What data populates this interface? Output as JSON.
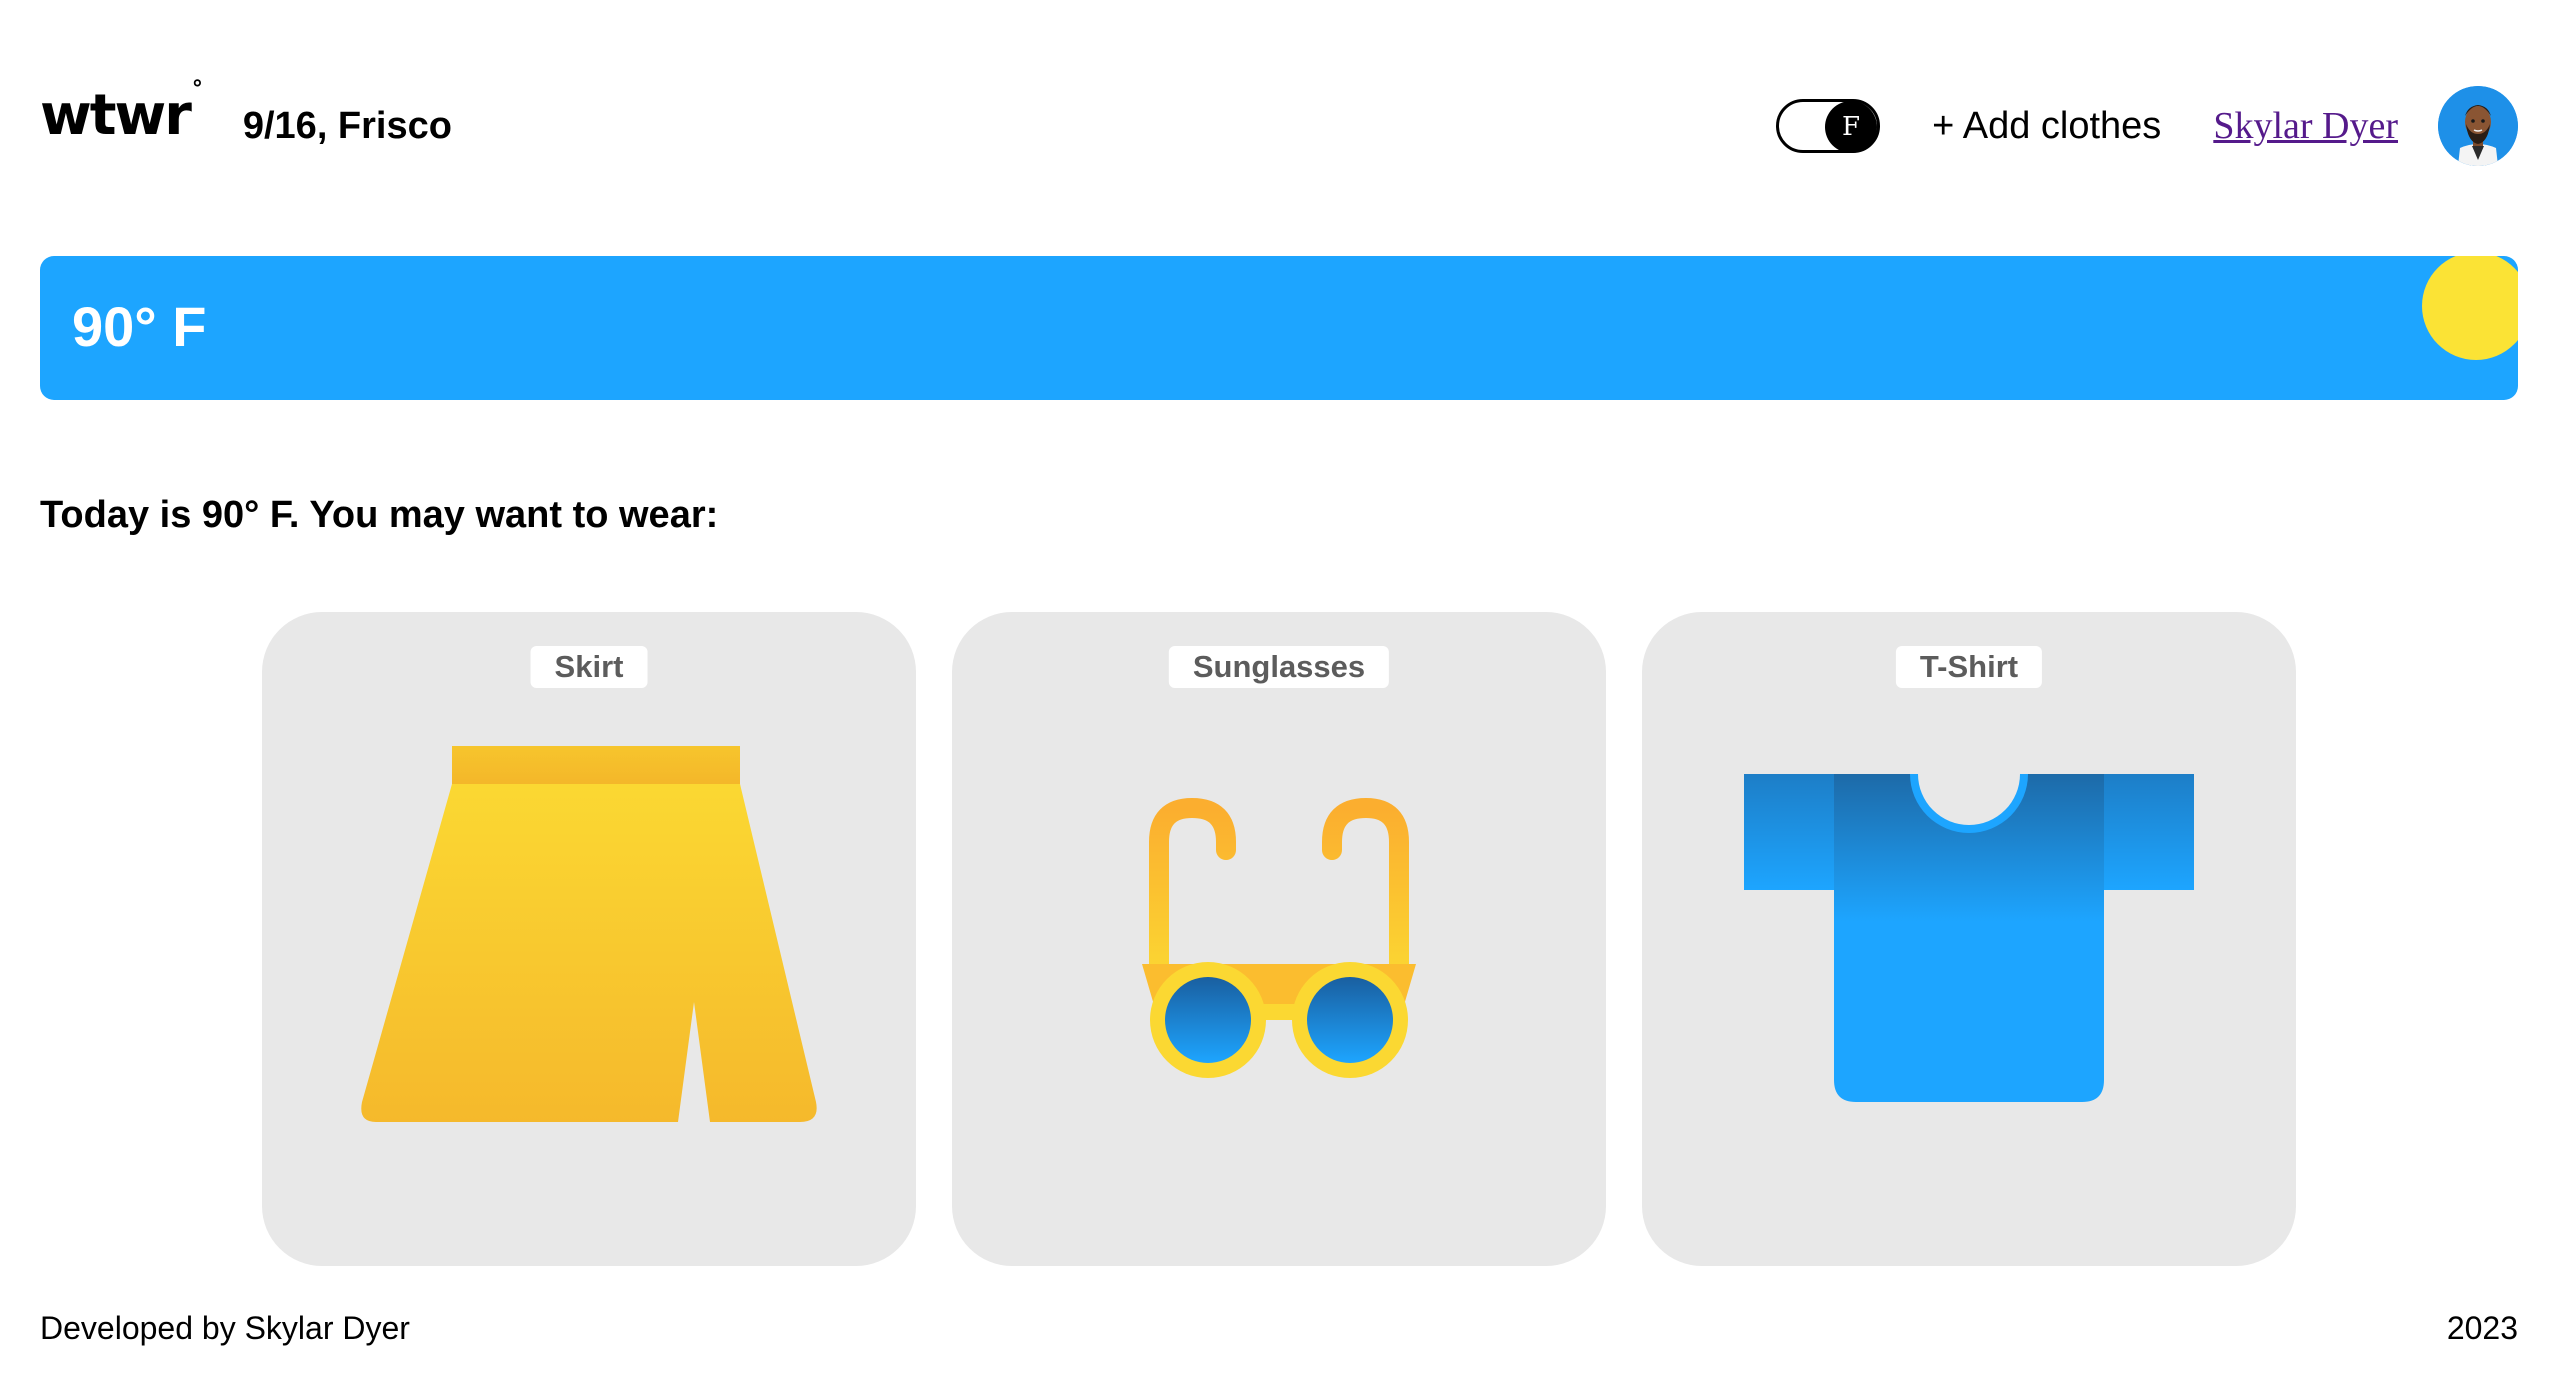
{
  "header": {
    "logo": "wtwr",
    "logo_degree": "°",
    "date_location": "9/16, Frisco",
    "temp_toggle_unit": "F",
    "add_clothes_label": "+ Add clothes",
    "user_name": "Skylar Dyer"
  },
  "weather": {
    "temperature": "90° F"
  },
  "main": {
    "suggestion": "Today is 90° F. You may want to wear:"
  },
  "cards": [
    {
      "label": "Skirt",
      "icon": "skirt-icon"
    },
    {
      "label": "Sunglasses",
      "icon": "sunglasses-icon"
    },
    {
      "label": "T-Shirt",
      "icon": "tshirt-icon"
    }
  ],
  "footer": {
    "credit": "Developed by Skylar Dyer",
    "year": "2023"
  },
  "colors": {
    "banner": "#1da5ff",
    "sun": "#fbe335",
    "card_bg": "#e8e8e8",
    "link": "#551a8b"
  }
}
